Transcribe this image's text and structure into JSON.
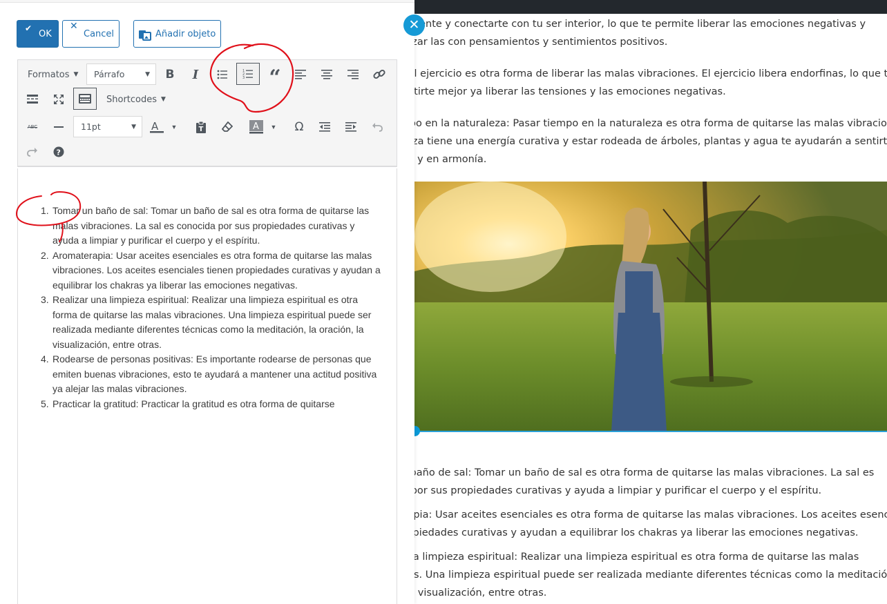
{
  "colors": {
    "primary": "#2271b1",
    "close_fab": "#169ad6",
    "annotation": "#e0101a",
    "topbar": "#23282d"
  },
  "background": {
    "paragraphs": [
      {
        "lines": [
          "o tu mente y conectarte con tu ser interior, lo que te permite liberar las emociones negativas y",
          "mplazar las con pensamientos y sentimientos positivos."
        ]
      },
      {
        "lines": [
          "cio: El ejercicio es otra forma de liberar las malas vibraciones. El ejercicio libera endorfinas, lo que te",
          "a sentirte mejor ya liberar las tensiones y las emociones negativas."
        ]
      },
      {
        "lines": [
          "tiempo en la naturaleza: Pasar tiempo en la naturaleza es otra forma de quitarse las malas vibracion",
          "uraleza tiene una energía curativa y estar rodeada de árboles, plantas y agua te ayudarán a sentirte",
          "n paz y en armonía."
        ]
      },
      {
        "lines": [
          "r un baño de sal: Tomar un baño de sal es otra forma de quitarse las malas vibraciones. La sal es",
          "cida por sus propiedades curativas y ayuda a limpiar y purificar el cuerpo y el espíritu."
        ]
      },
      {
        "lines": [
          "aterapia: Usar aceites esenciales es otra forma de quitarse las malas vibraciones. Los aceites esencia",
          "n propiedades curativas y ayudan a equilibrar los chakras ya liberar las emociones negativas."
        ]
      },
      {
        "lines": [
          "ar una limpieza espiritual: Realizar una limpieza espiritual es otra forma de quitarse las malas",
          "ciones. Una limpieza espiritual puede ser realizada mediante diferentes técnicas como la meditación",
          "ón, la visualización, entre otras."
        ]
      }
    ],
    "close_icon": "close-icon"
  },
  "buttons": {
    "ok_label": "OK",
    "cancel_label": "Cancel",
    "add_object_label": "Añadir objeto"
  },
  "toolbar": {
    "formats_label": "Formatos",
    "paragraph_value": "Párrafo",
    "shortcodes_label": "Shortcodes",
    "font_size_value": "11pt",
    "strikethrough_label": "ABC",
    "icons": [
      "bold-icon",
      "italic-icon",
      "bulleted-list-icon",
      "numbered-list-icon",
      "blockquote-icon",
      "align-left-icon",
      "align-center-icon",
      "align-right-icon",
      "link-icon",
      "read-more-icon",
      "fullscreen-icon",
      "toolbar-toggle-icon",
      "strikethrough-icon",
      "horizontal-line-icon",
      "text-color-icon",
      "paste-text-icon",
      "clear-formatting-icon",
      "background-color-icon",
      "special-character-icon",
      "outdent-icon",
      "indent-icon",
      "undo-icon",
      "redo-icon",
      "help-icon"
    ]
  },
  "editor": {
    "list": [
      {
        "num": "1.",
        "lines": [
          "Tomar un baño de sal: Tomar un baño de sal es otra forma de quitarse las",
          "malas vibraciones. La sal es conocida por sus propiedades curativas y",
          "ayuda a limpiar y purificar el cuerpo y el espíritu."
        ]
      },
      {
        "num": "2.",
        "lines": [
          "Aromaterapia: Usar aceites esenciales es otra forma de quitarse las malas",
          "vibraciones. Los aceites esenciales tienen propiedades curativas y ayudan a",
          "equilibrar los chakras ya liberar las emociones negativas."
        ]
      },
      {
        "num": "3.",
        "lines": [
          "Realizar una limpieza espiritual: Realizar una limpieza espiritual es otra",
          "forma de quitarse las malas vibraciones. Una limpieza espiritual puede ser",
          "realizada mediante diferentes técnicas como la meditación, la oración, la",
          "visualización, entre otras."
        ]
      },
      {
        "num": "4.",
        "lines": [
          "Rodearse de personas positivas: Es importante rodearse de personas que",
          "emiten buenas vibraciones, esto te ayudará a mantener una actitud positiva",
          "ya alejar las malas vibraciones."
        ]
      },
      {
        "num": "5.",
        "lines": [
          "Practicar la gratitud: Practicar la gratitud es otra forma de quitarse"
        ]
      }
    ]
  }
}
